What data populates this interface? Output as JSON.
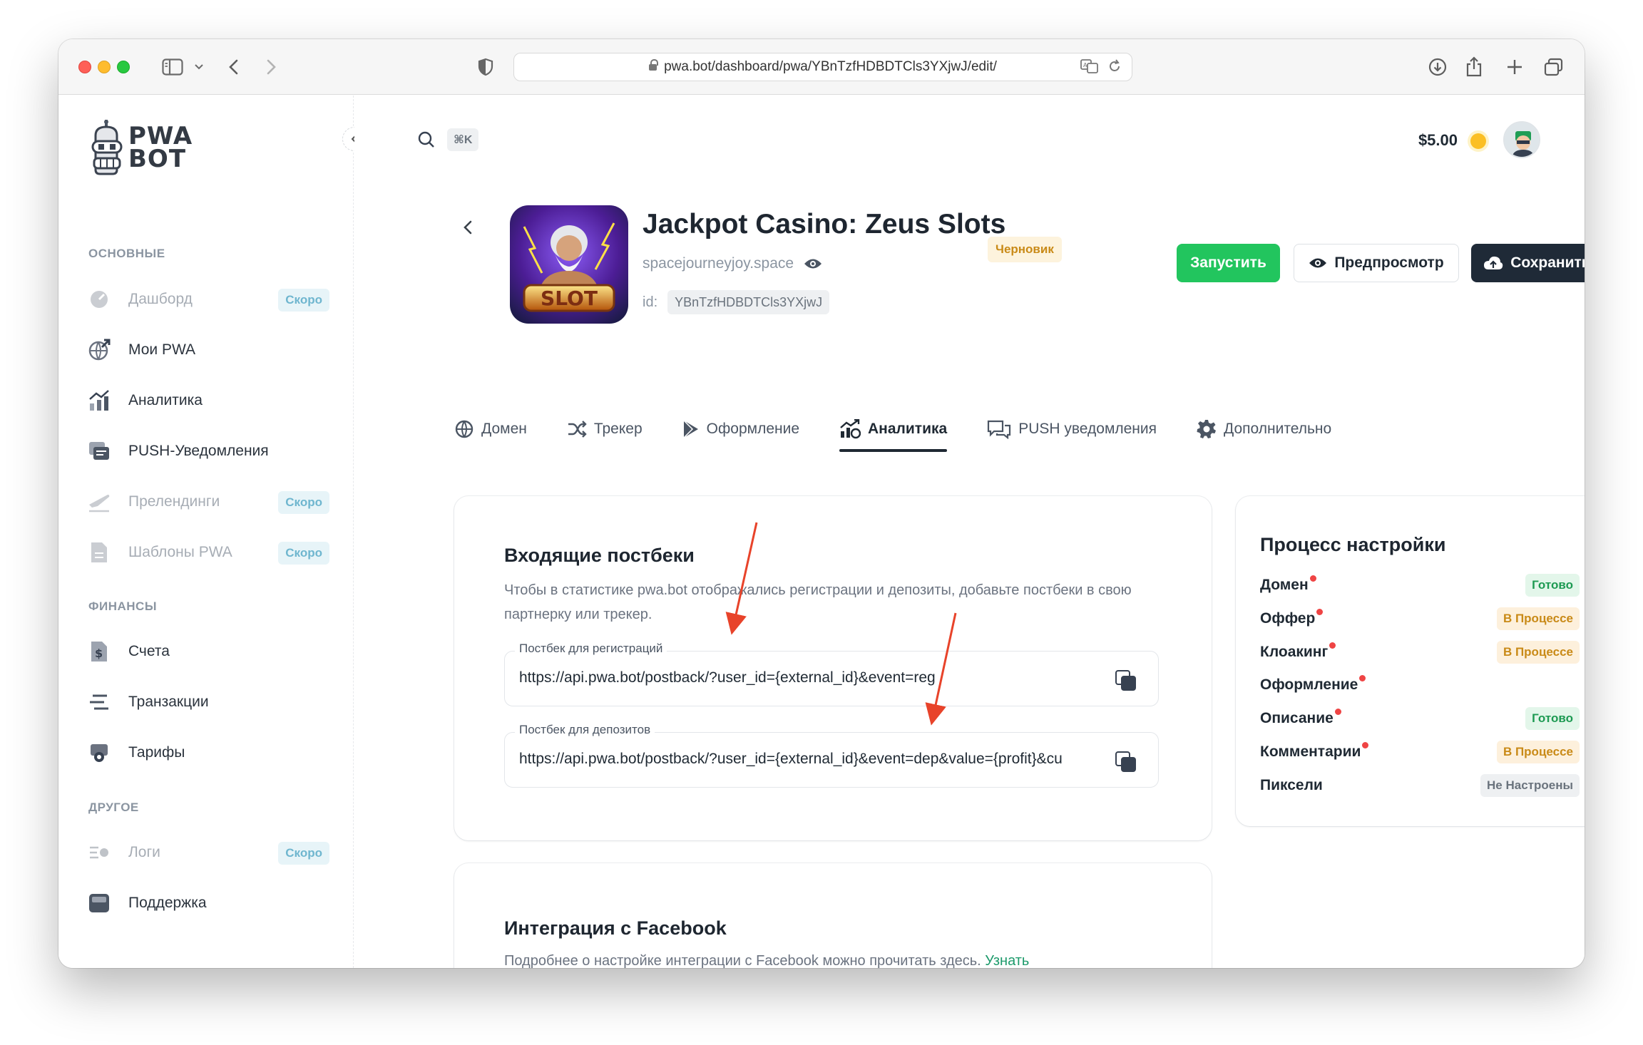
{
  "browser": {
    "url": "pwa.bot/dashboard/pwa/YBnTzfHDBDTCls3YXjwJ/edit/"
  },
  "sidebar": {
    "logo_line1": "PWA",
    "logo_line2": "BOT",
    "sections": [
      {
        "title": "ОСНОВНЫЕ",
        "items": [
          {
            "label": "Дашборд",
            "badge": "Скоро",
            "icon": "dashboard-gauge-icon"
          },
          {
            "label": "Мои PWA",
            "icon": "globe-arrow-icon"
          },
          {
            "label": "Аналитика",
            "icon": "bar-chart-icon"
          },
          {
            "label": "PUSH-Уведомления",
            "icon": "push-notification-icon"
          },
          {
            "label": "Прелендинги",
            "badge": "Скоро",
            "icon": "airplane-icon"
          },
          {
            "label": "Шаблоны PWA",
            "badge": "Скоро",
            "icon": "document-icon"
          }
        ]
      },
      {
        "title": "ФИНАНСЫ",
        "items": [
          {
            "label": "Счета",
            "icon": "dollar-document-icon"
          },
          {
            "label": "Транзакции",
            "icon": "lines-icon"
          },
          {
            "label": "Тарифы",
            "icon": "tariff-icon"
          }
        ]
      },
      {
        "title": "ДРУГОЕ",
        "items": [
          {
            "label": "Логи",
            "badge": "Скоро",
            "icon": "logs-icon"
          },
          {
            "label": "Поддержка",
            "icon": "inbox-icon"
          }
        ]
      }
    ]
  },
  "topbar": {
    "search_shortcut": "⌘K",
    "balance": "$5.00"
  },
  "app": {
    "title": "Jackpot Casino: Zeus Slots",
    "status": "Черновик",
    "domain": "spacejourneyjoy.space",
    "id_label": "id:",
    "id": "YBnTzfHDBDTCls3YXjwJ",
    "icon_text": "SLOT"
  },
  "actions": {
    "run": "Запустить",
    "preview": "Предпросмотр",
    "save": "Сохранить"
  },
  "tabs": [
    {
      "label": "Домен",
      "icon": "globe-icon"
    },
    {
      "label": "Трекер",
      "icon": "shuffle-icon"
    },
    {
      "label": "Оформление",
      "icon": "play-store-icon"
    },
    {
      "label": "Аналитика",
      "icon": "analytics-icon",
      "active": true
    },
    {
      "label": "PUSH уведомления",
      "icon": "chat-bubbles-icon"
    },
    {
      "label": "Дополнительно",
      "icon": "gear-icon"
    }
  ],
  "postbacks": {
    "title": "Входящие постбеки",
    "description": "Чтобы в статистике pwa.bot отображались регистрации и депозиты, добавьте постбеки в свою партнерку или трекер.",
    "reg_label": "Постбек для регистраций",
    "reg_value": "https://api.pwa.bot/postback/?user_id={external_id}&event=reg",
    "dep_label": "Постбек для депозитов",
    "dep_value": "https://api.pwa.bot/postback/?user_id={external_id}&event=dep&value={profit}&cu"
  },
  "facebook": {
    "title": "Интеграция с Facebook",
    "description": "Подробнее о настройке интеграции с Facebook можно прочитать здесь.",
    "link": "Узнать подробнее"
  },
  "process": {
    "title": "Процесс настройки",
    "items": [
      {
        "name": "Домен",
        "status": "Готово",
        "kind": "ok",
        "dot": true
      },
      {
        "name": "Оффер",
        "status": "В Процессе",
        "kind": "proc",
        "dot": true
      },
      {
        "name": "Клоакинг",
        "status": "В Процессе",
        "kind": "proc",
        "dot": true
      },
      {
        "name": "Оформление",
        "status": "",
        "kind": "",
        "dot": true
      },
      {
        "name": "Описание",
        "status": "Готово",
        "kind": "ok",
        "dot": true
      },
      {
        "name": "Комментарии",
        "status": "В Процессе",
        "kind": "proc",
        "dot": true
      },
      {
        "name": "Пиксели",
        "status": "Не Настроены",
        "kind": "none",
        "dot": false
      }
    ]
  },
  "colors": {
    "run_green": "#22c55e",
    "save_dark": "#1f2a37",
    "annotation_arrow": "#e8432a",
    "link_green": "#1d9a6b"
  }
}
